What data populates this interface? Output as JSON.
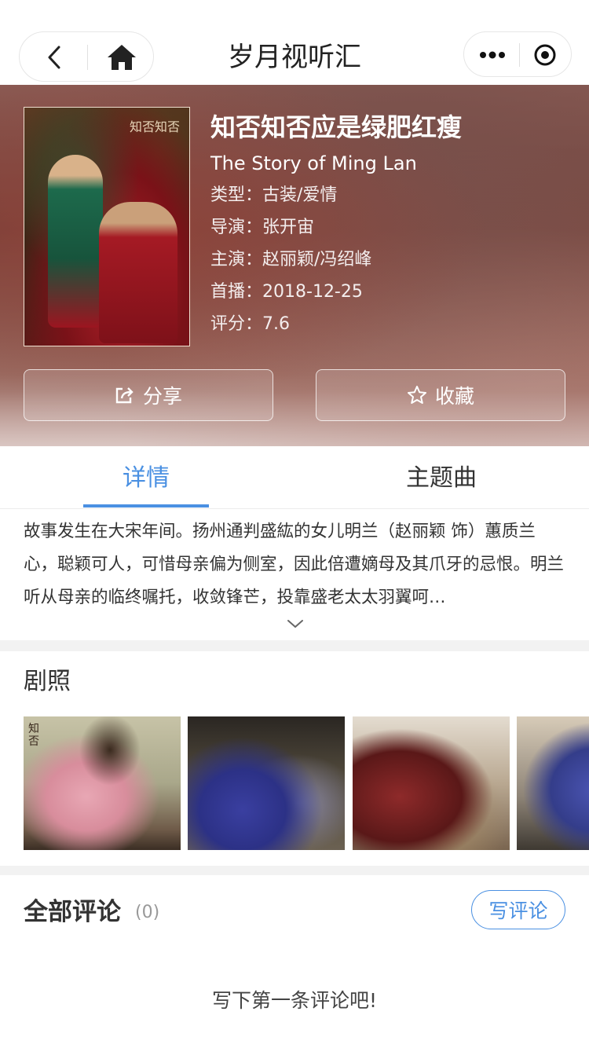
{
  "navbar": {
    "title": "岁月视听汇",
    "back_icon": "chevron-left-icon",
    "home_icon": "home-icon",
    "more_icon": "more-dots-icon",
    "target_icon": "target-icon"
  },
  "show": {
    "title_cn": "知否知否应是绿肥红瘦",
    "title_en": "The Story of Ming Lan",
    "genre_label": "类型：",
    "genre": "古装/爱情",
    "director_label": "导演：",
    "director": "张开宙",
    "cast_label": "主演：",
    "cast": "赵丽颖/冯绍峰",
    "premiere_label": "首播：",
    "premiere": "2018-12-25",
    "rating_label": "评分：",
    "rating": "7.6",
    "poster_text": "知否知否"
  },
  "actions": {
    "share_label": "分享",
    "favorite_label": "收藏"
  },
  "tabs": [
    {
      "label": "详情",
      "active": true
    },
    {
      "label": "主题曲",
      "active": false
    }
  ],
  "synopsis": "故事发生在大宋年间。扬州通判盛紘的女儿明兰（赵丽颖 饰）蕙质兰心，聪颖可人，可惜母亲偏为侧室，因此倍遭嫡母及其爪牙的忌恨。明兰听从母亲的临终嘱托，收敛锋芒，投靠盛老太太羽翼呵…",
  "stills": {
    "title": "剧照",
    "still_text": "知否"
  },
  "comments": {
    "title": "全部评论",
    "count": "(0)",
    "write_label": "写评论",
    "empty_tip": "写下第一条评论吧!"
  },
  "colors": {
    "accent": "#4a90e2",
    "hero_base": "#7a4a43"
  }
}
